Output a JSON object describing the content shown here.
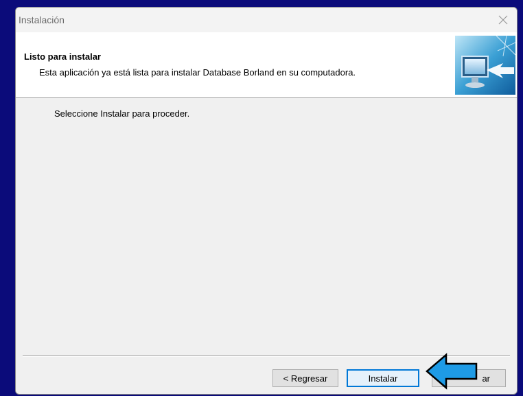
{
  "window": {
    "title": "Instalación"
  },
  "header": {
    "title": "Listo para instalar",
    "subtitle": "Esta aplicación ya está lista para instalar Database Borland en su computadora."
  },
  "body": {
    "message": "Seleccione Instalar para proceder."
  },
  "buttons": {
    "back_label": "< Regresar",
    "install_label": "Instalar",
    "cancel_label_visible": "ar"
  },
  "icons": {
    "close": "close-icon",
    "setup_logo": "setup-computer-icon",
    "pointer": "arrow-left-icon"
  },
  "colors": {
    "accent": "#0078d7",
    "arrow_fill": "#1e9be6",
    "background": "#0b0b7a"
  }
}
